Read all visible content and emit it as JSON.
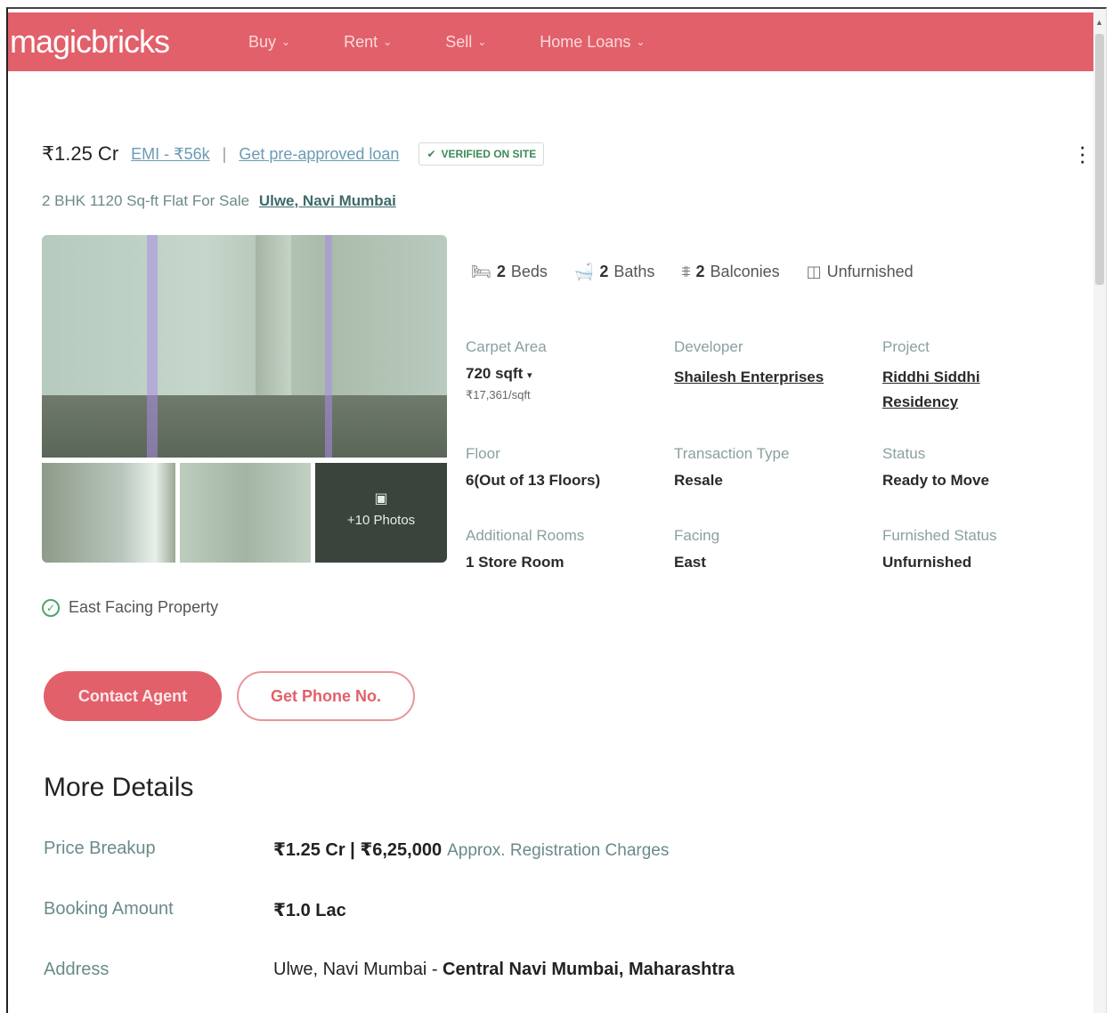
{
  "header": {
    "logo": "magicbricks",
    "nav": [
      {
        "label": "Buy"
      },
      {
        "label": "Rent"
      },
      {
        "label": "Sell"
      },
      {
        "label": "Home Loans"
      }
    ]
  },
  "listing": {
    "price": "₹1.25 Cr",
    "emi": "EMI - ₹56k",
    "separator": "|",
    "loan_link": "Get pre-approved loan",
    "verified": "VERIFIED ON SITE",
    "subtitle": "2 BHK 1120 Sq-ft Flat For Sale",
    "location": "Ulwe, Navi Mumbai",
    "photos_more": "+10 Photos"
  },
  "amenities": [
    {
      "count": "2",
      "label": "Beds",
      "icon": "bed-icon"
    },
    {
      "count": "2",
      "label": "Baths",
      "icon": "bath-icon"
    },
    {
      "count": "2",
      "label": "Balconies",
      "icon": "balcony-icon"
    },
    {
      "count": "",
      "label": "Unfurnished",
      "icon": "wardrobe-icon"
    }
  ],
  "details": {
    "carpet_area": {
      "label": "Carpet Area",
      "value": "720 sqft",
      "sub": "₹17,361/sqft"
    },
    "developer": {
      "label": "Developer",
      "value": "Shailesh Enterprises"
    },
    "project": {
      "label": "Project",
      "value_line1": "Riddhi Siddhi",
      "value_line2": "Residency"
    },
    "floor": {
      "label": "Floor",
      "value": "6(Out of 13 Floors)"
    },
    "transaction": {
      "label": "Transaction Type",
      "value": "Resale"
    },
    "status": {
      "label": "Status",
      "value": "Ready to Move"
    },
    "additional_rooms": {
      "label": "Additional Rooms",
      "value": "1 Store Room"
    },
    "facing": {
      "label": "Facing",
      "value": "East"
    },
    "furnished": {
      "label": "Furnished Status",
      "value": "Unfurnished"
    }
  },
  "highlight": "East Facing Property",
  "buttons": {
    "contact": "Contact Agent",
    "phone": "Get Phone No."
  },
  "more_details": {
    "title": "More Details",
    "price_breakup": {
      "label": "Price Breakup",
      "value": "₹1.25 Cr | ₹6,25,000",
      "note": "Approx. Registration Charges"
    },
    "booking": {
      "label": "Booking Amount",
      "value": "₹1.0 Lac"
    },
    "address": {
      "label": "Address",
      "value_a": "Ulwe, Navi Mumbai - ",
      "value_b": "Central Navi Mumbai, Maharashtra"
    }
  },
  "colors": {
    "brand": "#e2606a",
    "verified": "#3c8b56",
    "link": "#6a9bb4"
  }
}
